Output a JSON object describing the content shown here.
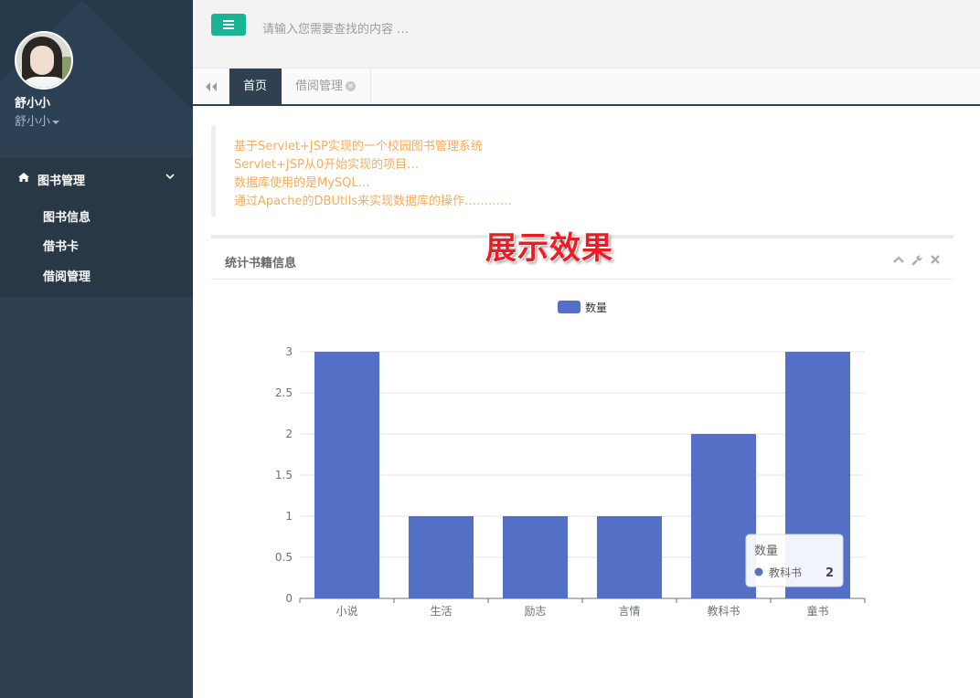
{
  "sidebar": {
    "user_name": "舒小小",
    "user_role": "舒小小",
    "menu": {
      "group_label": "图书管理",
      "items": [
        {
          "label": "图书信息"
        },
        {
          "label": "借书卡"
        },
        {
          "label": "借阅管理"
        }
      ]
    }
  },
  "topbar": {
    "search_placeholder": "请输入您需要查找的内容 …"
  },
  "tabs": [
    {
      "label": "首页",
      "active": true
    },
    {
      "label": "借阅管理",
      "active": false
    }
  ],
  "intro": [
    "基于Servlet+JSP实现的一个校园图书管理系统",
    "Servlet+JSP从0开始实现的项目…",
    "数据库使用的是MySQL…",
    "通过Apache的DBUtils来实现数据库的操作…………"
  ],
  "overlay_title": "展示效果",
  "panel": {
    "title": "统计书籍信息"
  },
  "colors": {
    "sidebar": "#2f4050",
    "accent": "#1ab394",
    "bar": "#5470c6",
    "intro_text": "#f8ac59",
    "overlay": "#ed1c24"
  },
  "chart_data": {
    "type": "bar",
    "title": "",
    "legend": [
      "数量"
    ],
    "legend_position": "top-center",
    "categories": [
      "小说",
      "生活",
      "励志",
      "言情",
      "教科书",
      "童书"
    ],
    "series": [
      {
        "name": "数量",
        "values": [
          3,
          1,
          1,
          1,
          2,
          3
        ]
      }
    ],
    "ylim": [
      0,
      3
    ],
    "yticks": [
      "0",
      "0.5",
      "1",
      "1.5",
      "2",
      "2.5",
      "3"
    ],
    "grid": true,
    "tooltip": {
      "series": "数量",
      "category": "教科书",
      "value": "2"
    }
  }
}
